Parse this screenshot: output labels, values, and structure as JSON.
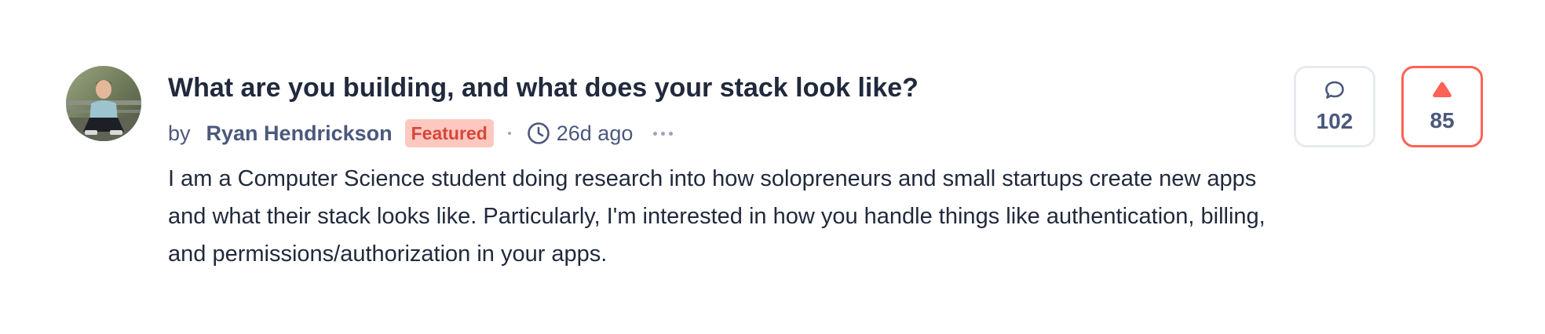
{
  "post": {
    "title": "What are you building, and what does your stack look like?",
    "by_label": "by",
    "author": "Ryan Hendrickson",
    "badge": "Featured",
    "time_ago": "26d ago",
    "body": "I am a Computer Science student doing research into how solopreneurs and small startups cre­ate new apps and what their stack looks like. Particularly, I'm interested in how you handle things like authentication, billing, and permissions/authorization in your apps."
  },
  "stats": {
    "comments": "102",
    "upvotes": "85"
  },
  "icons": {
    "comment": "comment-bubble-icon",
    "upvote": "upvote-triangle-icon",
    "clock": "clock-icon",
    "more": "more-dots-icon"
  },
  "colors": {
    "accent": "#ff6154",
    "badge_bg": "#fcc8c0",
    "badge_text": "#d6473a",
    "text_dark": "#21293c",
    "text_muted": "#4b587c"
  }
}
